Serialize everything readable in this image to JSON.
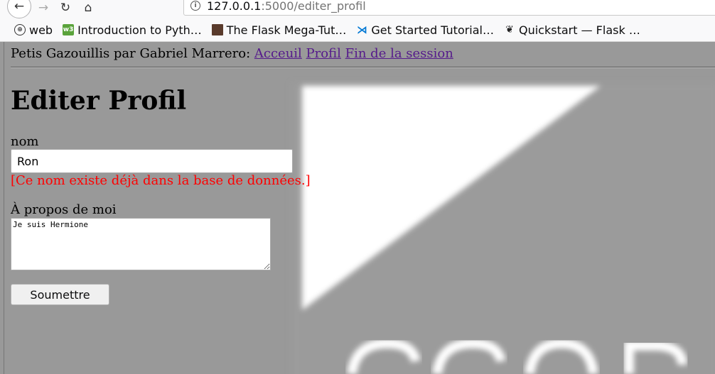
{
  "browser": {
    "url_host": "127.0.0.1",
    "url_path": ":5000/editer_profil",
    "nav": {
      "back_icon": "←",
      "forward_icon": "→",
      "reload_icon": "↻",
      "home_icon": "⌂",
      "info_icon": "i"
    },
    "bookmarks": [
      {
        "label": "web",
        "icon": "globe-icon"
      },
      {
        "label": "Introduction to Pyth…",
        "icon": "python-icon"
      },
      {
        "label": "The Flask Mega-Tut…",
        "icon": "flask-mega-icon"
      },
      {
        "label": "Get Started Tutorial…",
        "icon": "vscode-icon"
      },
      {
        "label": "Quickstart — Flask …",
        "icon": "flask-icon"
      }
    ]
  },
  "site": {
    "nav_prefix": "Petis Gazouillis par Gabriel Marrero:",
    "links": [
      "Acceuil",
      "Profil",
      "Fin de la session"
    ],
    "link_color": "#551a8b"
  },
  "form": {
    "title": "Editer Profil",
    "nom_label": "nom",
    "nom_value": "Ron",
    "nom_error": "[Ce nom existe déjà dans la base de données.]",
    "error_color": "#ff0000",
    "about_label": "À propos de moi",
    "about_value": "Je suis Hermione",
    "submit_label": "Soumettre"
  },
  "colors": {
    "page_background": "#999999"
  }
}
